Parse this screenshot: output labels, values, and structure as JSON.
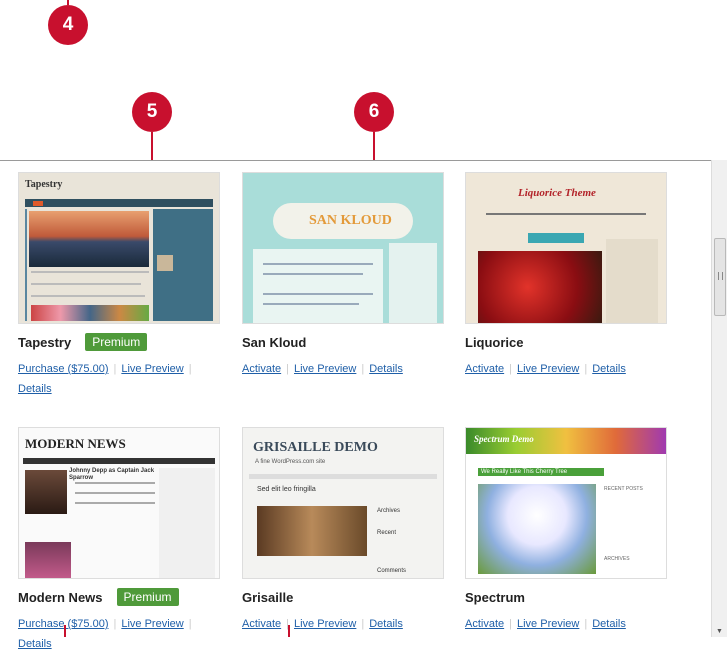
{
  "callouts": {
    "c4": "4",
    "c5": "5",
    "c6": "6"
  },
  "themes": [
    {
      "name": "Tapestry",
      "badge": "Premium",
      "purchase": "Purchase ($75.00)",
      "preview": "Live Preview",
      "details": "Details",
      "shot": {
        "title": "Tapestry"
      }
    },
    {
      "name": "San Kloud",
      "activate": "Activate",
      "preview": "Live Preview",
      "details": "Details",
      "shot": {
        "title": "SAN KLOUD"
      }
    },
    {
      "name": "Liquorice",
      "activate": "Activate",
      "preview": "Live Preview",
      "details": "Details",
      "shot": {
        "title": "Liquorice Theme"
      }
    },
    {
      "name": "Modern News",
      "badge": "Premium",
      "purchase": "Purchase ($75.00)",
      "preview": "Live Preview",
      "details": "Details",
      "shot": {
        "title": "MODERN NEWS",
        "headline": "Johnny Depp as Captain Jack Sparrow"
      }
    },
    {
      "name": "Grisaille",
      "activate": "Activate",
      "preview": "Live Preview",
      "details": "Details",
      "shot": {
        "title": "GRISAILLE DEMO",
        "tagline": "A fine WordPress.com site",
        "post": "Sed elit leo fringilla",
        "side1": "Archives",
        "side2": "Recent",
        "side3": "Comments"
      }
    },
    {
      "name": "Spectrum",
      "activate": "Activate",
      "preview": "Live Preview",
      "details": "Details",
      "shot": {
        "title": "Spectrum Demo",
        "post": "We Really Like This Cherry Tree",
        "side1": "RECENT POSTS",
        "side2": "ARCHIVES"
      }
    }
  ],
  "colors": {
    "callout": "#c8102e",
    "badge": "#4f9a3a",
    "link": "#1f5fa8"
  }
}
